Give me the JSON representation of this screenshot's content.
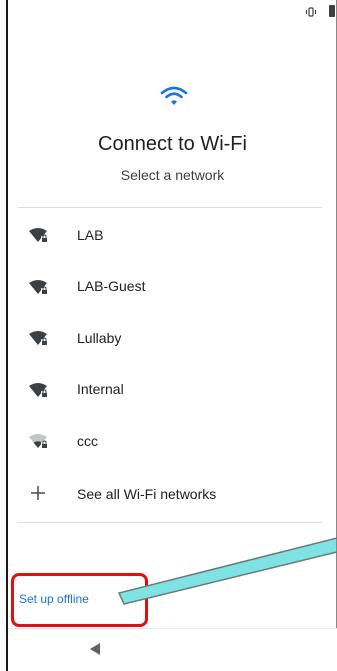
{
  "header": {
    "title": "Connect to Wi-Fi",
    "subtitle": "Select a network"
  },
  "networks": [
    {
      "name": "LAB",
      "icon": "wifi-locked-icon"
    },
    {
      "name": "LAB-Guest",
      "icon": "wifi-locked-icon"
    },
    {
      "name": "Lullaby",
      "icon": "wifi-locked-icon"
    },
    {
      "name": "Internal",
      "icon": "wifi-locked-icon"
    },
    {
      "name": "ccc",
      "icon": "wifi-locked-weak-icon"
    }
  ],
  "see_all": {
    "label": "See all Wi-Fi networks",
    "icon": "plus-icon"
  },
  "footer": {
    "offline_label": "Set up offline"
  },
  "colors": {
    "accent": "#1a73e8",
    "highlight": "#e01010",
    "pointer": "#7fe3e3",
    "text": "#202124"
  }
}
